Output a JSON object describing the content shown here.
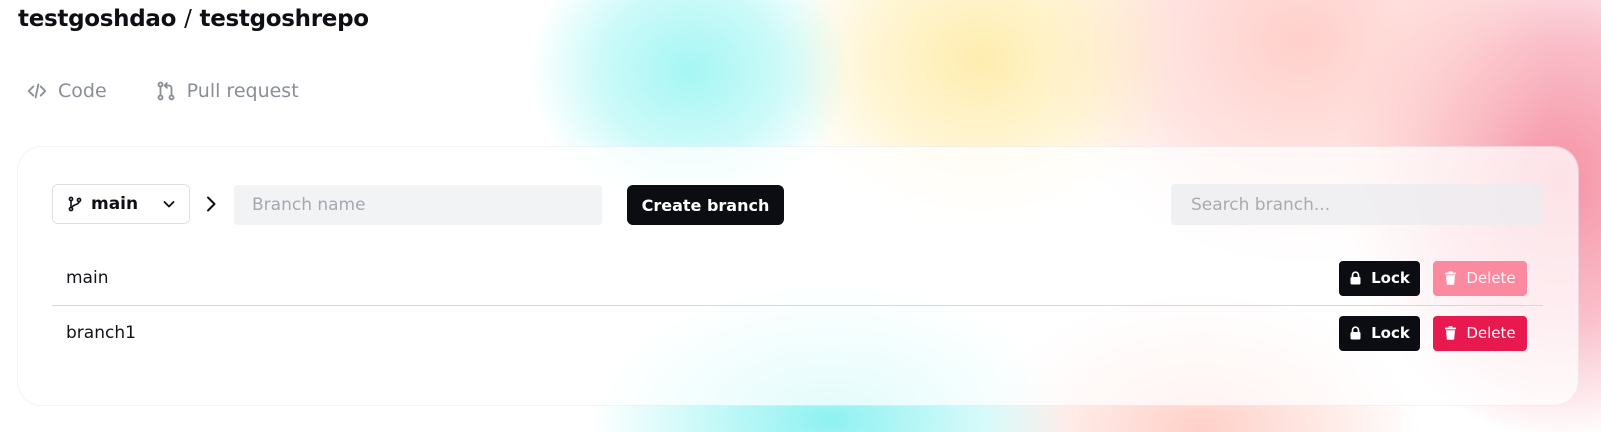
{
  "header": {
    "org": "testgoshdao",
    "separator": "/",
    "repo": "testgoshrepo"
  },
  "tabs": [
    {
      "label": "Code",
      "icon": "code-icon"
    },
    {
      "label": "Pull request",
      "icon": "pull-request-icon"
    }
  ],
  "toolbar": {
    "selected_branch": "main",
    "branch_name_placeholder": "Branch name",
    "create_branch_label": "Create branch",
    "search_placeholder": "Search branch..."
  },
  "branches": [
    {
      "name": "main",
      "lock_label": "Lock",
      "delete_label": "Delete",
      "delete_disabled": true
    },
    {
      "name": "branch1",
      "lock_label": "Lock",
      "delete_label": "Delete",
      "delete_disabled": false
    }
  ],
  "colors": {
    "primary_button": "#0b0d12",
    "delete_button": "#e8194f",
    "delete_button_disabled": "#fb8aa0",
    "tab_text": "#8a8e96"
  }
}
